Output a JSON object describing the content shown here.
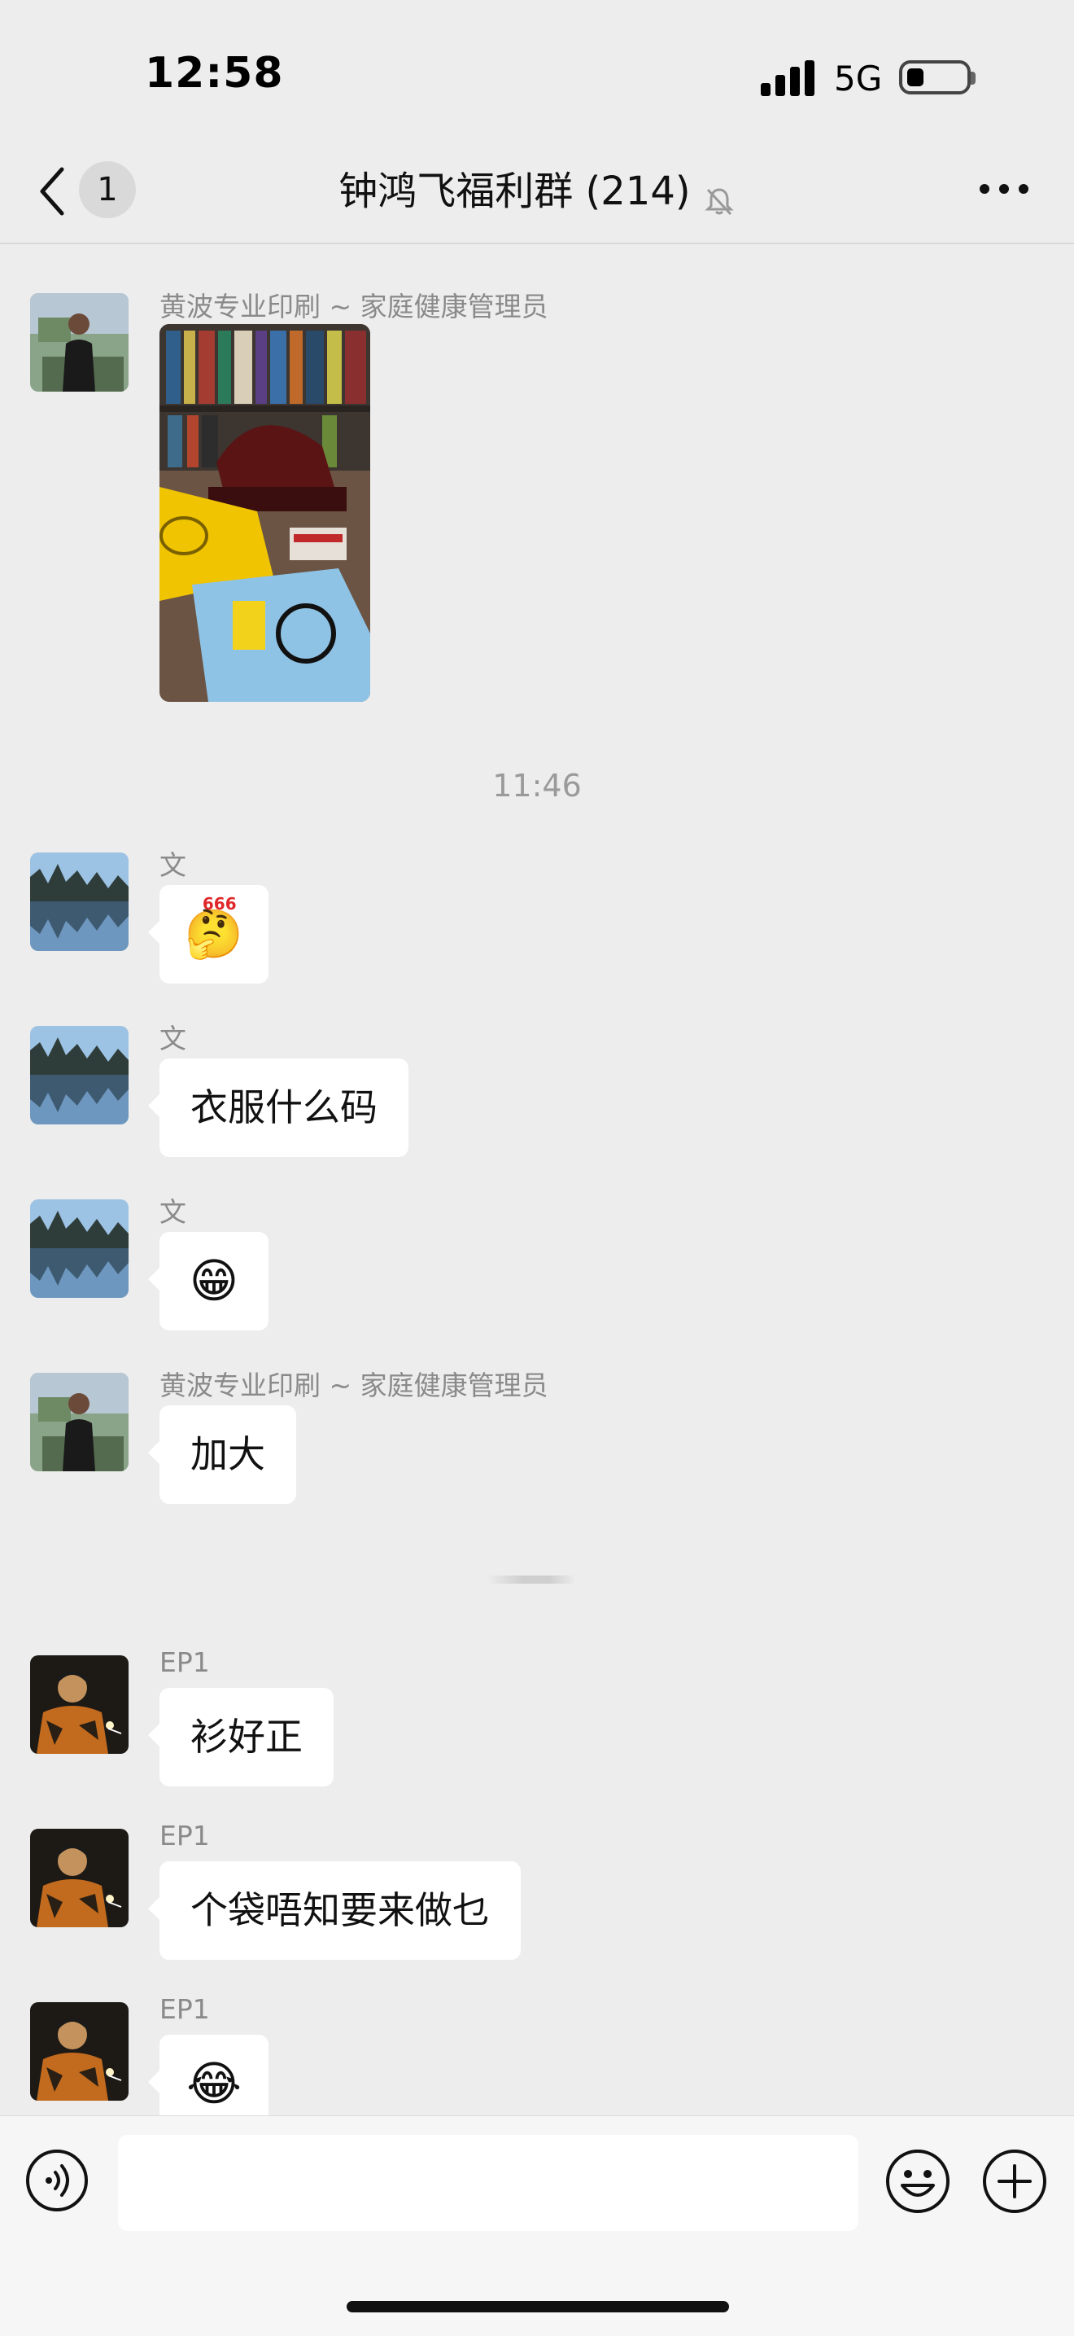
{
  "status_bar": {
    "time": "12:58",
    "network": "5G"
  },
  "header": {
    "back_count": "1",
    "title": "钟鸿飞福利群 (214)",
    "muted": true
  },
  "messages": [
    {
      "sender": "黄波专业印刷 ~ 家庭健康管理员",
      "type": "image",
      "avatar": "man-dark-shirt"
    },
    {
      "type": "timestamp",
      "text": "11:46"
    },
    {
      "sender": "文",
      "type": "emoji",
      "emoji": "🤔",
      "badge": "666",
      "avatar": "lake-mountains"
    },
    {
      "sender": "文",
      "type": "text",
      "text": "衣服什么码",
      "avatar": "lake-mountains"
    },
    {
      "sender": "文",
      "type": "emoji",
      "emoji": "😁",
      "avatar": "lake-mountains"
    },
    {
      "sender": "黄波专业印刷 ~ 家庭健康管理员",
      "type": "text",
      "text": "加大",
      "avatar": "man-dark-shirt"
    },
    {
      "sender": "EP1",
      "type": "text",
      "text": "衫好正",
      "avatar": "man-night"
    },
    {
      "sender": "EP1",
      "type": "text",
      "text": "个袋唔知要来做乜",
      "avatar": "man-night"
    },
    {
      "sender": "EP1",
      "type": "emoji",
      "emoji": "😂",
      "avatar": "man-night"
    }
  ],
  "input_bar": {
    "placeholder": "",
    "icons": [
      "voice-icon",
      "emoji-icon",
      "plus-icon"
    ]
  }
}
